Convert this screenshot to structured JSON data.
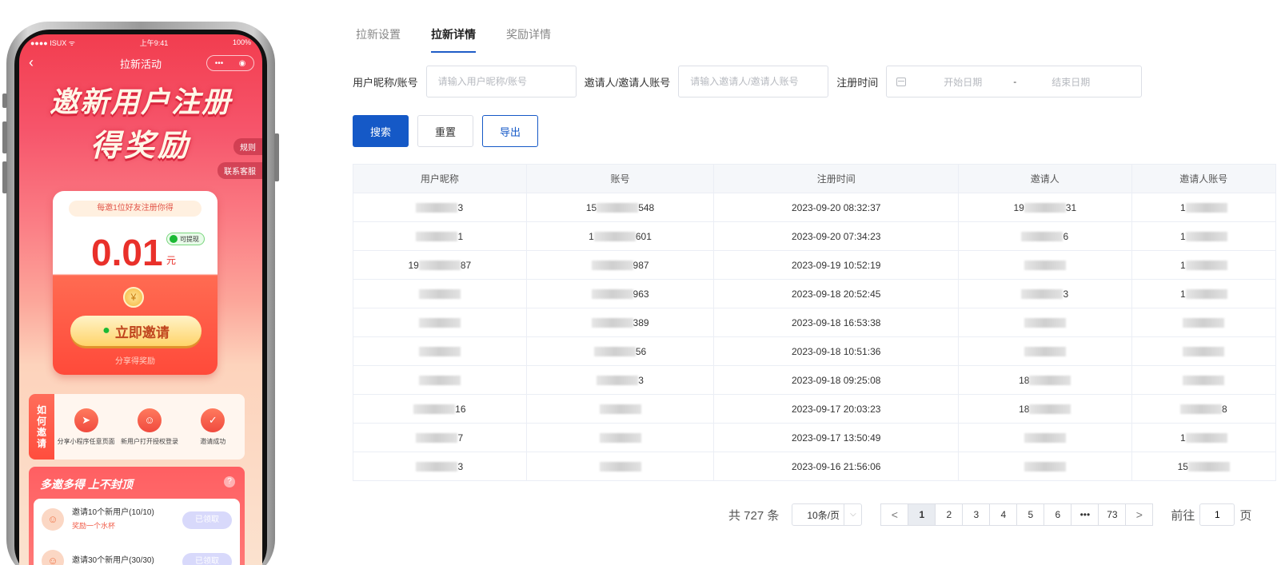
{
  "phone": {
    "status": {
      "carrier": "●●●● ISUX ᯤ",
      "time": "上午9:41",
      "battery": "100%"
    },
    "nav_title": "拉新活动",
    "hero_line1": "邀新用户注册",
    "hero_line2": "得奖励",
    "rules_tag": "规则",
    "service_tag": "联系客服",
    "card_head": "每邀1位好友注册你得",
    "amount": "0.01",
    "unit": "元",
    "withdraw_badge": "可提现",
    "invite_button": "立即邀请",
    "share_hint": "分享得奖励",
    "how_label": "如何邀请",
    "steps": [
      {
        "label": "分享小程序任意页面"
      },
      {
        "label": "新用户打开授权登录"
      },
      {
        "label": "邀请成功"
      }
    ],
    "more_title": "多邀多得 上不封顶",
    "tasks": [
      {
        "title": "邀请10个新用户(10/10)",
        "sub": "奖励一个水杯",
        "button": "已领取"
      },
      {
        "title": "邀请30个新用户(30/30)",
        "sub": "",
        "button": "已领取"
      }
    ]
  },
  "tabs": [
    {
      "label": "拉新设置",
      "active": false
    },
    {
      "label": "拉新详情",
      "active": true
    },
    {
      "label": "奖励详情",
      "active": false
    }
  ],
  "filters": {
    "nickname_label": "用户昵称/账号",
    "nickname_placeholder": "请输入用户昵称/账号",
    "inviter_label": "邀请人/邀请人账号",
    "inviter_placeholder": "请输入邀请人/邀请人账号",
    "regtime_label": "注册时间",
    "start_placeholder": "开始日期",
    "range_sep": "-",
    "end_placeholder": "结束日期"
  },
  "buttons": {
    "search": "搜索",
    "reset": "重置",
    "export": "导出"
  },
  "table": {
    "columns": [
      "用户昵称",
      "账号",
      "注册时间",
      "邀请人",
      "邀请人账号"
    ],
    "rows": [
      {
        "nickname": [
          "",
          "3"
        ],
        "account": [
          "15",
          "548"
        ],
        "time": "2023-09-20 08:32:37",
        "inviter": [
          "19",
          "31"
        ],
        "inviter_account": [
          "1",
          ""
        ]
      },
      {
        "nickname": [
          "",
          "1"
        ],
        "account": [
          "1",
          "601"
        ],
        "time": "2023-09-20 07:34:23",
        "inviter": [
          "",
          "6"
        ],
        "inviter_account": [
          "1",
          ""
        ]
      },
      {
        "nickname": [
          "19",
          "87"
        ],
        "account": [
          "",
          "987"
        ],
        "time": "2023-09-19 10:52:19",
        "inviter": [
          "",
          ""
        ],
        "inviter_account": [
          "1",
          ""
        ]
      },
      {
        "nickname": [
          "",
          ""
        ],
        "account": [
          "",
          "963"
        ],
        "time": "2023-09-18 20:52:45",
        "inviter": [
          "",
          "3"
        ],
        "inviter_account": [
          "1",
          ""
        ]
      },
      {
        "nickname": [
          "",
          ""
        ],
        "account": [
          "",
          "389"
        ],
        "time": "2023-09-18 16:53:38",
        "inviter": [
          "",
          ""
        ],
        "inviter_account": [
          "",
          ""
        ]
      },
      {
        "nickname": [
          "",
          ""
        ],
        "account": [
          "",
          "56"
        ],
        "time": "2023-09-18 10:51:36",
        "inviter": [
          "",
          ""
        ],
        "inviter_account": [
          "",
          ""
        ]
      },
      {
        "nickname": [
          "",
          ""
        ],
        "account": [
          "",
          "3"
        ],
        "time": "2023-09-18 09:25:08",
        "inviter": [
          "18",
          ""
        ],
        "inviter_account": [
          "",
          ""
        ]
      },
      {
        "nickname": [
          "",
          "16"
        ],
        "account": [
          "",
          ""
        ],
        "time": "2023-09-17 20:03:23",
        "inviter": [
          "18",
          ""
        ],
        "inviter_account": [
          "",
          "8"
        ]
      },
      {
        "nickname": [
          "",
          "7"
        ],
        "account": [
          "",
          ""
        ],
        "time": "2023-09-17 13:50:49",
        "inviter": [
          "",
          ""
        ],
        "inviter_account": [
          "1",
          ""
        ]
      },
      {
        "nickname": [
          "",
          "3"
        ],
        "account": [
          "",
          ""
        ],
        "time": "2023-09-16 21:56:06",
        "inviter": [
          "",
          ""
        ],
        "inviter_account": [
          "15",
          ""
        ]
      }
    ]
  },
  "pagination": {
    "total": "共 727 条",
    "page_size": "10条/页",
    "prev": "<",
    "pages": [
      "1",
      "2",
      "3",
      "4",
      "5",
      "6",
      "•••",
      "73"
    ],
    "current": "1",
    "next": ">",
    "goto_prefix": "前往",
    "goto_value": "1",
    "goto_suffix": "页"
  },
  "colors": {
    "primary": "#1559c7",
    "hero_red": "#f23d4f",
    "amount_red": "#e9302a"
  },
  "icons": {
    "nav_back": "chevron-left-icon",
    "capsule_more": "more-dots-icon",
    "capsule_close": "target-close-icon",
    "wechat": "wechat-icon",
    "coin": "yuan-coin-icon",
    "steps": [
      "paper-plane-icon",
      "user-add-icon",
      "check-doc-icon"
    ],
    "help": "question-icon",
    "calendar": "calendar-icon"
  }
}
